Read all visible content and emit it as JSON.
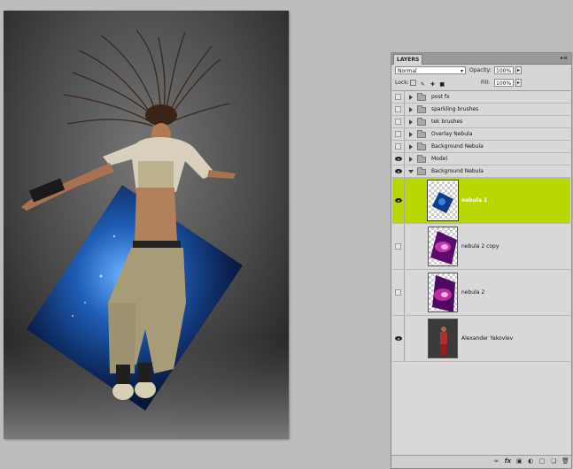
{
  "canvas": {
    "photo_description_icon": "dancer-photo-icon"
  },
  "layers_panel": {
    "tab_label": "LAYERS",
    "menu_icon": "▸≡",
    "blend_mode": "Normal",
    "opacity_label": "Opacity:",
    "opacity_value": "100%",
    "lock_label": "Lock:",
    "fill_label": "Fill:",
    "fill_value": "100%",
    "layers": [
      {
        "name": "post fx",
        "visible": false,
        "type": "group",
        "expanded": false
      },
      {
        "name": "sparkling brushes",
        "visible": false,
        "type": "group",
        "expanded": false
      },
      {
        "name": "tek brushes",
        "visible": false,
        "type": "group",
        "expanded": false
      },
      {
        "name": "Overlay Nebula",
        "visible": false,
        "type": "group",
        "expanded": false
      },
      {
        "name": "Background Nebula",
        "visible": false,
        "type": "group",
        "expanded": false
      },
      {
        "name": "Model",
        "visible": true,
        "type": "group",
        "expanded": false
      },
      {
        "name": "Background Nebula",
        "visible": true,
        "type": "group",
        "expanded": true
      },
      {
        "name": "nebula 1",
        "visible": true,
        "type": "layer",
        "selected": true
      },
      {
        "name": "nebula 2 copy",
        "visible": false,
        "type": "layer"
      },
      {
        "name": "nebula 2",
        "visible": false,
        "type": "layer"
      },
      {
        "name": "Alexander Yakovlev",
        "visible": true,
        "type": "layer"
      }
    ],
    "bottom_icons": [
      "link-icon",
      "fx-icon",
      "mask-icon",
      "adjustment-icon",
      "folder-icon",
      "new-layer-icon",
      "trash-icon"
    ],
    "selected_color": "#b8d800"
  }
}
